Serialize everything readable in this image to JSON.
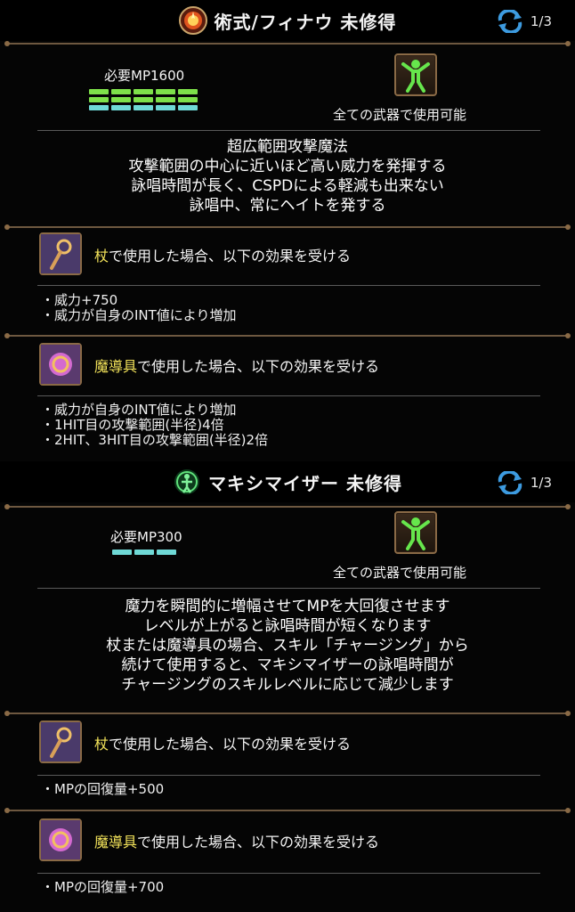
{
  "skills": [
    {
      "title": "術式/フィナウ 未修得",
      "title_icon": "finau-skill-icon",
      "page": "1/3",
      "mp_required": "必要MP1600",
      "weapon_note": "全ての武器で使用可能",
      "description": [
        "超広範囲攻撃魔法",
        "攻撃範囲の中心に近いほど高い威力を発揮する",
        "詠唱時間が長く、CSPDによる軽減も出来ない",
        "詠唱中、常にヘイトを発する"
      ],
      "weapons": [
        {
          "icon": "staff-icon",
          "name": "杖",
          "suffix": "で使用した場合、以下の効果を受ける",
          "effects": [
            "・威力+750",
            "・威力が自身のINT値により増加"
          ]
        },
        {
          "icon": "magic-device-icon",
          "name": "魔導具",
          "suffix": "で使用した場合、以下の効果を受ける",
          "effects": [
            "・威力が自身のINT値により増加",
            "・1HIT目の攻撃範囲(半径)4倍",
            "・2HIT、3HIT目の攻撃範囲(半径)2倍"
          ]
        }
      ]
    },
    {
      "title": "マキシマイザー 未修得",
      "title_icon": "maximizer-skill-icon",
      "page": "1/3",
      "mp_required": "必要MP300",
      "weapon_note": "全ての武器で使用可能",
      "description": [
        "魔力を瞬間的に増幅させてMPを大回復させます",
        "レベルが上がると詠唱時間が短くなります",
        "杖または魔導具の場合、スキル「チャージング」から",
        "続けて使用すると、マキシマイザーの詠唱時間が",
        "チャージングのスキルレベルに応じて減少します"
      ],
      "weapons": [
        {
          "icon": "staff-icon",
          "name": "杖",
          "suffix": "で使用した場合、以下の効果を受ける",
          "effects": [
            "・MPの回復量+500"
          ]
        },
        {
          "icon": "magic-device-icon",
          "name": "魔導具",
          "suffix": "で使用した場合、以下の効果を受ける",
          "effects": [
            "・MPの回復量+700"
          ]
        }
      ]
    }
  ],
  "colors": {
    "mp_green": "#7ee04a",
    "mp_cyan": "#6fd9d6",
    "highlight": "#f3e35a",
    "frame_border": "#8a6a46",
    "rail": "#6e5840"
  },
  "mp_gauge": {
    "skill_1": {
      "green_segments": 10,
      "cyan_segments": 5
    },
    "skill_2": {
      "green_segments": 0,
      "cyan_segments": 3
    }
  }
}
